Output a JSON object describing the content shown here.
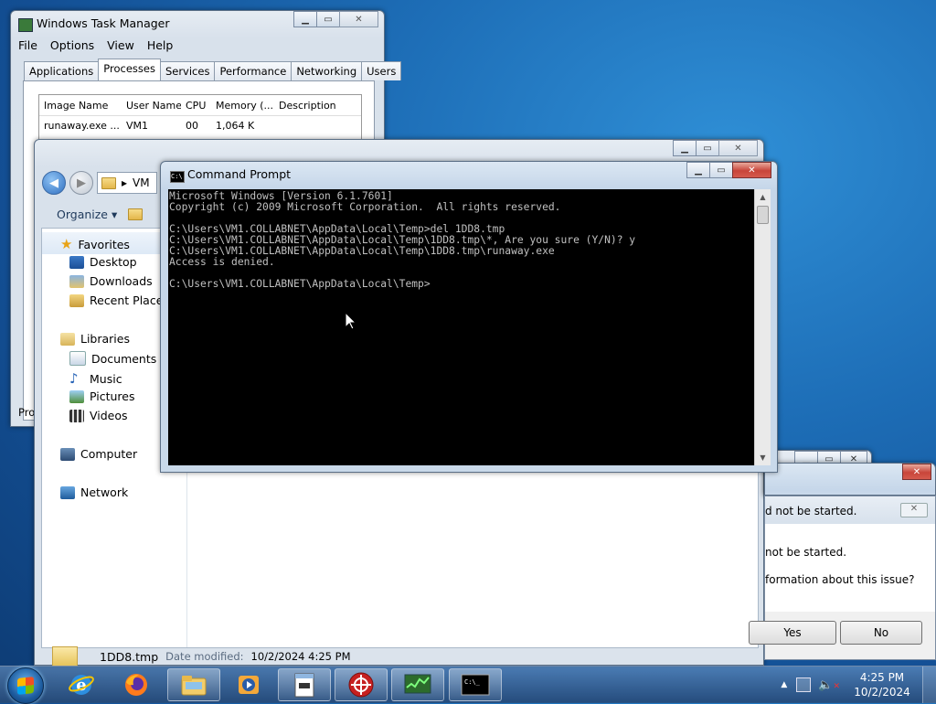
{
  "taskmgr": {
    "title": "Windows Task Manager",
    "menu": [
      "File",
      "Options",
      "View",
      "Help"
    ],
    "tabs": [
      "Applications",
      "Processes",
      "Services",
      "Performance",
      "Networking",
      "Users"
    ],
    "active_tab": "Processes",
    "columns": [
      "Image Name",
      "User Name",
      "CPU",
      "Memory (...",
      "Description"
    ],
    "rows": [
      [
        "runaway.exe ...",
        "VM1",
        "00",
        "1,064 K",
        ""
      ]
    ],
    "status": "Pro"
  },
  "explorer": {
    "address": "VM",
    "organize": "Organize ▾",
    "nav": {
      "favorites": "Favorites",
      "desktop": "Desktop",
      "downloads": "Downloads",
      "recent": "Recent Places",
      "libraries": "Libraries",
      "documents": "Documents",
      "music": "Music",
      "pictures": "Pictures",
      "videos": "Videos",
      "computer": "Computer",
      "network": "Network"
    },
    "status_file": "1DD8.tmp",
    "status_modified_label": "Date modified:",
    "status_modified": "10/2/2024 4:25 PM"
  },
  "cmd": {
    "title": "Command Prompt",
    "lines": [
      "Microsoft Windows [Version 6.1.7601]",
      "Copyright (c) 2009 Microsoft Corporation.  All rights reserved.",
      "",
      "C:\\Users\\VM1.COLLABNET\\AppData\\Local\\Temp>del 1DD8.tmp",
      "C:\\Users\\VM1.COLLABNET\\AppData\\Local\\Temp\\1DD8.tmp\\*, Are you sure (Y/N)? y",
      "C:\\Users\\VM1.COLLABNET\\AppData\\Local\\Temp\\1DD8.tmp\\runaway.exe",
      "Access is denied.",
      "",
      "C:\\Users\\VM1.COLLABNET\\AppData\\Local\\Temp>"
    ]
  },
  "dialog": {
    "header": "d not be started.",
    "line1": "not be started.",
    "line2": "formation about this issue?",
    "yes": "Yes",
    "no": "No"
  },
  "taskbar": {
    "time": "4:25 PM",
    "date": "10/2/2024",
    "apps": [
      "internet-explorer-icon",
      "firefox-icon",
      "explorer-icon",
      "media-player-icon",
      "notepad-icon",
      "tool-icon",
      "task-manager-icon",
      "cmd-icon"
    ]
  }
}
